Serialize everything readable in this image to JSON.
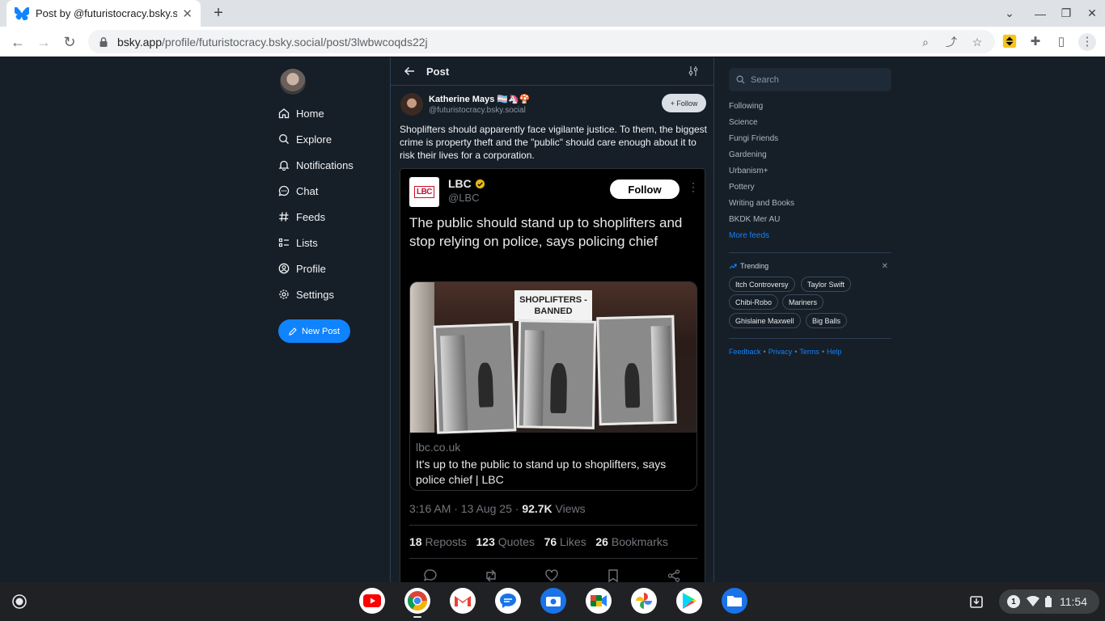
{
  "browser": {
    "tab_title": "Post by @futuristocracy.bsky.so",
    "url_domain": "bsky.app",
    "url_path": "/profile/futuristocracy.bsky.social/post/3lwbwcoqds22j"
  },
  "nav": {
    "items": [
      {
        "label": "Home",
        "icon": "home-icon"
      },
      {
        "label": "Explore",
        "icon": "search-icon"
      },
      {
        "label": "Notifications",
        "icon": "bell-icon"
      },
      {
        "label": "Chat",
        "icon": "chat-icon"
      },
      {
        "label": "Feeds",
        "icon": "hash-icon"
      },
      {
        "label": "Lists",
        "icon": "list-icon"
      },
      {
        "label": "Profile",
        "icon": "profile-icon"
      },
      {
        "label": "Settings",
        "icon": "gear-icon"
      }
    ],
    "new_post": "New Post"
  },
  "post_view": {
    "header": "Post",
    "author_name": "Katherine Mays 🏳️‍⚧️🦄🍄",
    "author_handle": "@futuristocracy.bsky.social",
    "follow_label": "+ Follow",
    "text": "Shoplifters should apparently face vigilante justice. To them, the biggest crime is property theft and the \"public\" should care enough about it to risk their lives for a corporation."
  },
  "embed": {
    "name": "LBC",
    "handle": "@LBC",
    "logo_text": "LBC",
    "follow_label": "Follow",
    "title": "The public should stand up to shoplifters and stop relying on police, says policing chief",
    "image_sign": "SHOPLIFTERS - BANNED",
    "card_domain": "lbc.co.uk",
    "card_title": "It's up to the public to stand up to shoplifters, says police chief | LBC",
    "time": "3:16 AM · 13 Aug 25 · ",
    "views_count": "92.7K",
    "views_label": " Views",
    "stats": [
      {
        "count": "18",
        "label": "Reposts"
      },
      {
        "count": "123",
        "label": "Quotes"
      },
      {
        "count": "76",
        "label": "Likes"
      },
      {
        "count": "26",
        "label": "Bookmarks"
      }
    ]
  },
  "sidebar": {
    "search_placeholder": "Search",
    "feeds": [
      "Following",
      "Science",
      "Fungi Friends",
      "Gardening",
      "Urbanism+",
      "Pottery",
      "Writing and Books",
      "BKDK Mer AU"
    ],
    "more_feeds": "More feeds",
    "trending_label": "Trending",
    "trending": [
      "Itch Controversy",
      "Taylor Swift",
      "Chibi-Robo",
      "Mariners",
      "Ghislaine Maxwell",
      "Big Balls"
    ],
    "footer": [
      "Feedback",
      "Privacy",
      "Terms",
      "Help"
    ]
  },
  "shelf": {
    "badge": "1",
    "time": "11:54"
  },
  "colors": {
    "accent": "#1083fe",
    "page_bg": "#161e27",
    "border": "#2e4052"
  }
}
